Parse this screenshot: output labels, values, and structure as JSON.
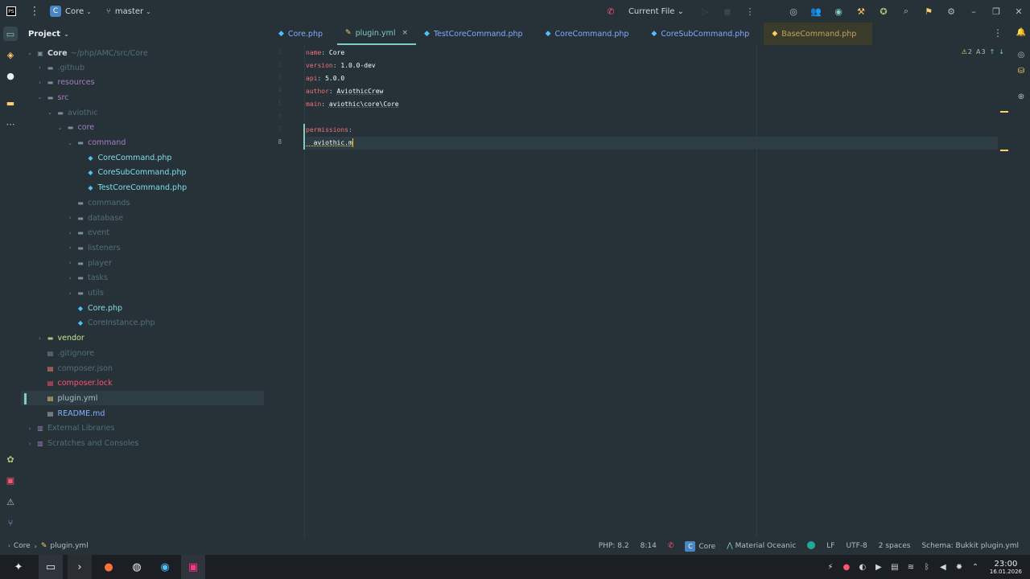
{
  "titlebar": {
    "project_badge": "C",
    "project_name": "Core",
    "branch": "master",
    "run_config": "Current File"
  },
  "project_panel": {
    "title": "Project",
    "root_name": "Core",
    "root_path": "~/php/AMC/src/Core",
    "items": [
      {
        "label": ".github",
        "depth": 1,
        "arrow": "›",
        "icon": "folder",
        "color": "grey"
      },
      {
        "label": "resources",
        "depth": 1,
        "arrow": "›",
        "icon": "folder",
        "color": "purple"
      },
      {
        "label": "src",
        "depth": 1,
        "arrow": "⌄",
        "icon": "folder",
        "color": "purple"
      },
      {
        "label": "aviothic",
        "depth": 2,
        "arrow": "⌄",
        "icon": "folder",
        "color": "grey"
      },
      {
        "label": "core",
        "depth": 3,
        "arrow": "⌄",
        "icon": "folder",
        "color": "purple"
      },
      {
        "label": "command",
        "depth": 4,
        "arrow": "⌄",
        "icon": "folder",
        "color": "purple"
      },
      {
        "label": "CoreCommand.php",
        "depth": 5,
        "arrow": "",
        "icon": "php",
        "color": "cyan"
      },
      {
        "label": "CoreSubCommand.php",
        "depth": 5,
        "arrow": "",
        "icon": "php",
        "color": "cyan"
      },
      {
        "label": "TestCoreCommand.php",
        "depth": 5,
        "arrow": "",
        "icon": "php",
        "color": "cyan"
      },
      {
        "label": "commands",
        "depth": 4,
        "arrow": "",
        "icon": "folder",
        "color": "dim"
      },
      {
        "label": "database",
        "depth": 4,
        "arrow": "›",
        "icon": "folder",
        "color": "grey"
      },
      {
        "label": "event",
        "depth": 4,
        "arrow": "›",
        "icon": "folder",
        "color": "grey"
      },
      {
        "label": "listeners",
        "depth": 4,
        "arrow": "›",
        "icon": "folder",
        "color": "grey"
      },
      {
        "label": "player",
        "depth": 4,
        "arrow": "›",
        "icon": "folder",
        "color": "grey"
      },
      {
        "label": "tasks",
        "depth": 4,
        "arrow": "›",
        "icon": "folder",
        "color": "grey"
      },
      {
        "label": "utils",
        "depth": 4,
        "arrow": "›",
        "icon": "folder",
        "color": "grey"
      },
      {
        "label": "Core.php",
        "depth": 4,
        "arrow": "",
        "icon": "php",
        "color": "cyan"
      },
      {
        "label": "CoreInstance.php",
        "depth": 4,
        "arrow": "",
        "icon": "php",
        "color": "grey"
      },
      {
        "label": "vendor",
        "depth": 1,
        "arrow": "›",
        "icon": "folder",
        "color": "orange"
      },
      {
        "label": ".gitignore",
        "depth": 1,
        "arrow": "",
        "icon": "file",
        "color": "grey"
      },
      {
        "label": "composer.json",
        "depth": 1,
        "arrow": "",
        "icon": "file",
        "color": "grey"
      },
      {
        "label": "composer.lock",
        "depth": 1,
        "arrow": "",
        "icon": "file",
        "color": "red"
      },
      {
        "label": "plugin.yml",
        "depth": 1,
        "arrow": "",
        "icon": "file",
        "color": "white"
      },
      {
        "label": "README.md",
        "depth": 1,
        "arrow": "",
        "icon": "file",
        "color": "blue"
      },
      {
        "label": "External Libraries",
        "depth": 0,
        "arrow": "›",
        "icon": "lib",
        "color": "grey"
      },
      {
        "label": "Scratches and Consoles",
        "depth": 0,
        "arrow": "›",
        "icon": "lib",
        "color": "grey"
      }
    ]
  },
  "tabs": [
    {
      "label": "Core.php"
    },
    {
      "label": "plugin.yml",
      "close": "×"
    },
    {
      "label": "TestCoreCommand.php"
    },
    {
      "label": "CoreCommand.php"
    },
    {
      "label": "CoreSubCommand.php"
    },
    {
      "label": "BaseCommand.php"
    }
  ],
  "editor": {
    "lines": [
      {
        "n": "1",
        "key": "name",
        "val": "Core"
      },
      {
        "n": "2",
        "key": "version",
        "val": "1.0.0-dev"
      },
      {
        "n": "3",
        "key": "api",
        "val": "5.0.0"
      },
      {
        "n": "4",
        "key": "author",
        "val": "AviothicCrew"
      },
      {
        "n": "5",
        "key": "main",
        "val": "aviothic\\core\\Core"
      },
      {
        "n": "6",
        "key": "",
        "val": ""
      },
      {
        "n": "7",
        "key": "permissions",
        "val": ""
      },
      {
        "n": "8",
        "key": "",
        "val": "  aviothic.m"
      }
    ],
    "inspection_warn": "2",
    "inspection_typo": "3"
  },
  "status": {
    "crumb_root": "Core",
    "crumb_file": "plugin.yml",
    "php_version": "PHP: 8.2",
    "position": "8:14",
    "project": "Core",
    "theme": "Material Oceanic",
    "line_sep": "LF",
    "encoding": "UTF-8",
    "indent": "2 spaces",
    "schema": "Schema: Bukkit plugin.yml"
  },
  "taskbar": {
    "time": "23:00",
    "date": "16.01.2026"
  },
  "colors": {
    "bg": "#263238",
    "accent": "#80cbc4",
    "key": "#f07178",
    "value": "#c3e88d"
  }
}
